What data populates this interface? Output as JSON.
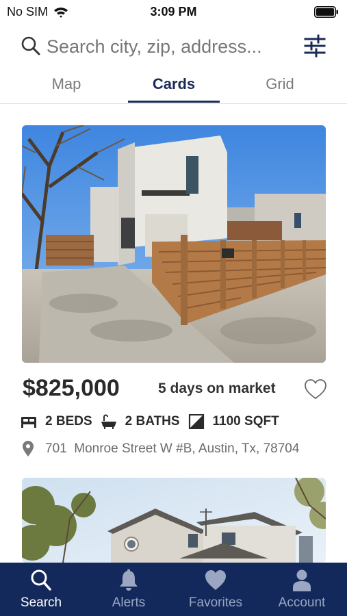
{
  "status_bar": {
    "carrier": "No SIM",
    "time": "3:09 PM"
  },
  "search": {
    "placeholder": "Search city, zip, address..."
  },
  "tabs": [
    {
      "label": "Map",
      "active": false
    },
    {
      "label": "Cards",
      "active": true
    },
    {
      "label": "Grid",
      "active": false
    }
  ],
  "listings": [
    {
      "price": "$825,000",
      "days_on_market": "5 days on market",
      "beds": "2 BEDS",
      "baths": "2 BATHS",
      "sqft": "1100 SQFT",
      "address": "701  Monroe Street W #B, Austin, Tx, 78704",
      "favorited": false
    }
  ],
  "bottom_nav": [
    {
      "label": "Search",
      "icon": "search-icon",
      "active": true
    },
    {
      "label": "Alerts",
      "icon": "bell-icon",
      "active": false
    },
    {
      "label": "Favorites",
      "icon": "heart-icon",
      "active": false
    },
    {
      "label": "Account",
      "icon": "person-icon",
      "active": false
    }
  ],
  "colors": {
    "brand_navy": "#13295c",
    "active_tab": "#1b2b58",
    "inactive_nav": "#9aa6c2"
  }
}
